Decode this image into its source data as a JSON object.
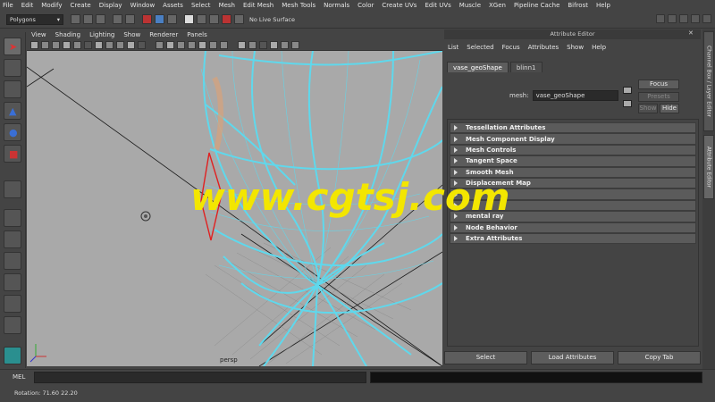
{
  "menubar": [
    "File",
    "Edit",
    "Modify",
    "Create",
    "Display",
    "Window",
    "Assets",
    "Select",
    "Mesh",
    "Edit Mesh",
    "Mesh Tools",
    "Normals",
    "Color",
    "Create UVs",
    "Edit UVs",
    "Muscle",
    "XGen",
    "Pipeline Cache",
    "Bifrost",
    "Help"
  ],
  "statusline": {
    "mode": "Polygons",
    "live_surface": "No Live Surface"
  },
  "viewport": {
    "menu": [
      "View",
      "Shading",
      "Lighting",
      "Show",
      "Renderer",
      "Panels"
    ],
    "camera_label": "persp"
  },
  "attribute_editor": {
    "title": "Attribute Editor",
    "menu": [
      "List",
      "Selected",
      "Focus",
      "Attributes",
      "Show",
      "Help"
    ],
    "tabs": [
      "vase_geoShape",
      "blinn1"
    ],
    "mesh_label": "mesh:",
    "mesh_value": "vase_geoShape",
    "focus_button": "Focus",
    "presets_button": "Presets",
    "show_button": "Show",
    "hide_button": "Hide",
    "sections": [
      "Tessellation Attributes",
      "Mesh Component Display",
      "Mesh Controls",
      "Tangent Space",
      "Smooth Mesh",
      "Displacement Map",
      "",
      "",
      "mental ray",
      "Node Behavior",
      "Extra Attributes"
    ],
    "select_button": "Select",
    "load_button": "Load Attributes",
    "copy_tab_button": "Copy Tab"
  },
  "side_tabs": [
    "Channel Box / Layer Editor",
    "Attribute Editor"
  ],
  "command_line": {
    "label": "MEL"
  },
  "help_line": {
    "text": "Rotation: 71.60 22.20"
  },
  "watermark": "www.cgtsj.com",
  "colors": {
    "wireframe": "#5fd8ec",
    "viewport_bg": "#a9a9a9",
    "selection": "#e02020",
    "watermark": "#f3e600"
  }
}
